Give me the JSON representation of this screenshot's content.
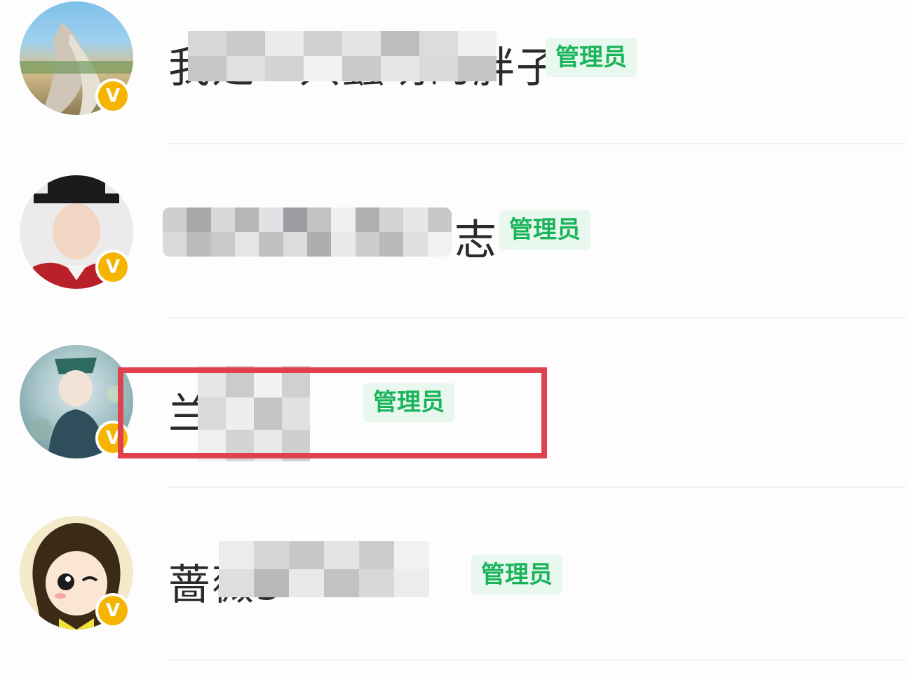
{
  "members": [
    {
      "name": "我是一只蠢萌的胖子",
      "role": "管理员",
      "verified": true,
      "highlighted": false
    },
    {
      "name": "志",
      "role": "管理员",
      "verified": true,
      "highlighted": false
    },
    {
      "name": "兰林",
      "role": "管理员",
      "verified": true,
      "highlighted": true
    },
    {
      "name": "蔷薇5",
      "role": "管理员",
      "verified": true,
      "highlighted": false
    }
  ],
  "badge_symbol": "V",
  "colors": {
    "role_text": "#19b45a",
    "role_bg": "#e8f8ee",
    "badge": "#f4b400",
    "highlight": "#e0414f"
  }
}
